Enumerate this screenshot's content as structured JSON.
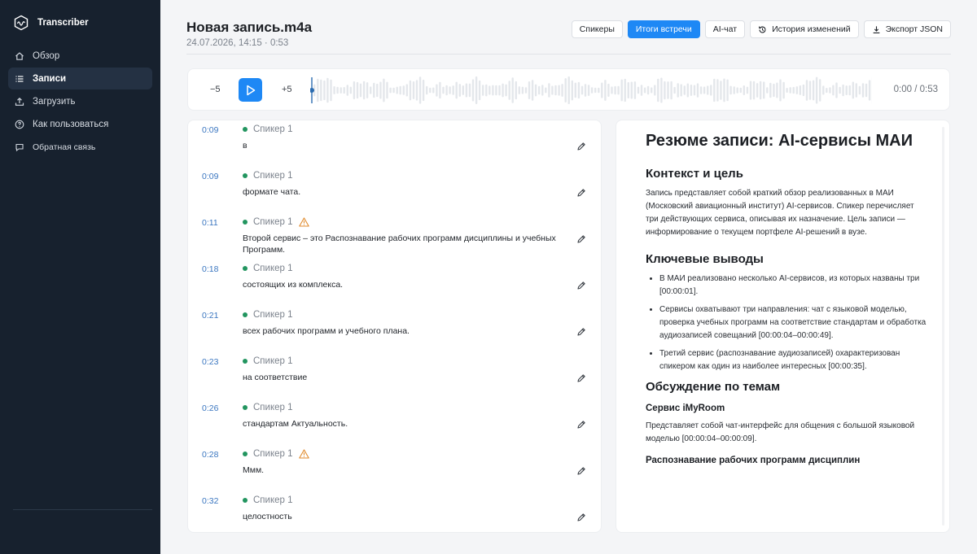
{
  "app": {
    "name": "Transcriber"
  },
  "sidebar": {
    "items": [
      {
        "label": "Обзор",
        "icon": "home-icon"
      },
      {
        "label": "Записи",
        "icon": "list-icon"
      },
      {
        "label": "Загрузить",
        "icon": "upload-icon"
      },
      {
        "label": "Как пользоваться",
        "icon": "help-icon"
      },
      {
        "label": "Обратная связь",
        "icon": "chat-icon"
      }
    ],
    "active_index": 1
  },
  "header": {
    "title": "Новая запись.m4a",
    "meta": "24.07.2026, 14:15 · 0:53",
    "buttons": {
      "speakers": "Спикеры",
      "summary": "Итоги встречи",
      "ai_chat": "AI-чат",
      "history": "История изменений",
      "export": "Экспорт JSON"
    }
  },
  "player": {
    "back_label": "−5",
    "forward_label": "+5",
    "time": "0:00 / 0:53",
    "progress": 0
  },
  "transcript": {
    "segments": [
      {
        "time": "0:09",
        "speaker": "Спикер 1",
        "text": "в",
        "warning": false
      },
      {
        "time": "0:09",
        "speaker": "Спикер 1",
        "text": "формате чата.",
        "warning": false
      },
      {
        "time": "0:11",
        "speaker": "Спикер 1",
        "text": "Второй сервис – это Распознавание рабочих программ дисциплины и учебных Программ.",
        "warning": true
      },
      {
        "time": "0:18",
        "speaker": "Спикер 1",
        "text": "состоящих из комплекса.",
        "warning": false
      },
      {
        "time": "0:21",
        "speaker": "Спикер 1",
        "text": "всех рабочих программ и учебного плана.",
        "warning": false
      },
      {
        "time": "0:23",
        "speaker": "Спикер 1",
        "text": "на соответствие",
        "warning": false
      },
      {
        "time": "0:26",
        "speaker": "Спикер 1",
        "text": "стандартам Актуальность.",
        "warning": false
      },
      {
        "time": "0:28",
        "speaker": "Спикер 1",
        "text": "Ммм.",
        "warning": true
      },
      {
        "time": "0:32",
        "speaker": "Спикер 1",
        "text": "целостность",
        "warning": false
      }
    ]
  },
  "summary": {
    "title": "Резюме записи: AI-сервисы МАИ",
    "context_heading": "Контекст и цель",
    "context_text": "Запись представляет собой краткий обзор реализованных в МАИ (Московский авиационный институт) AI-сервисов. Спикер перечисляет три действующих сервиса, описывая их назначение. Цель записи — информирование о текущем портфеле AI-решений в вузе.",
    "key_heading": "Ключевые выводы",
    "key_points": [
      "В МАИ реализовано несколько AI-сервисов, из которых названы три [00:00:01].",
      "Сервисы охватывают три направления: чат с языковой моделью, проверка учебных программ на соответствие стандартам и обработка аудиозаписей совещаний [00:00:04–00:00:49].",
      "Третий сервис (распознавание аудиозаписей) охарактеризован спикером как один из наиболее интересных [00:00:35]."
    ],
    "topics_heading": "Обсуждение по темам",
    "topic1_heading": "Сервис iMyRoom",
    "topic1_text": "Представляет собой чат-интерфейс для общения с большой языковой моделью [00:00:04–00:00:09].",
    "topic2_heading": "Распознавание рабочих программ дисциплин"
  },
  "colors": {
    "sidebar_bg": "#17212e",
    "accent": "#1e88f5",
    "speaker_dot": "#22955f",
    "warning": "#e08a2c",
    "timestamp": "#3a76c0"
  }
}
